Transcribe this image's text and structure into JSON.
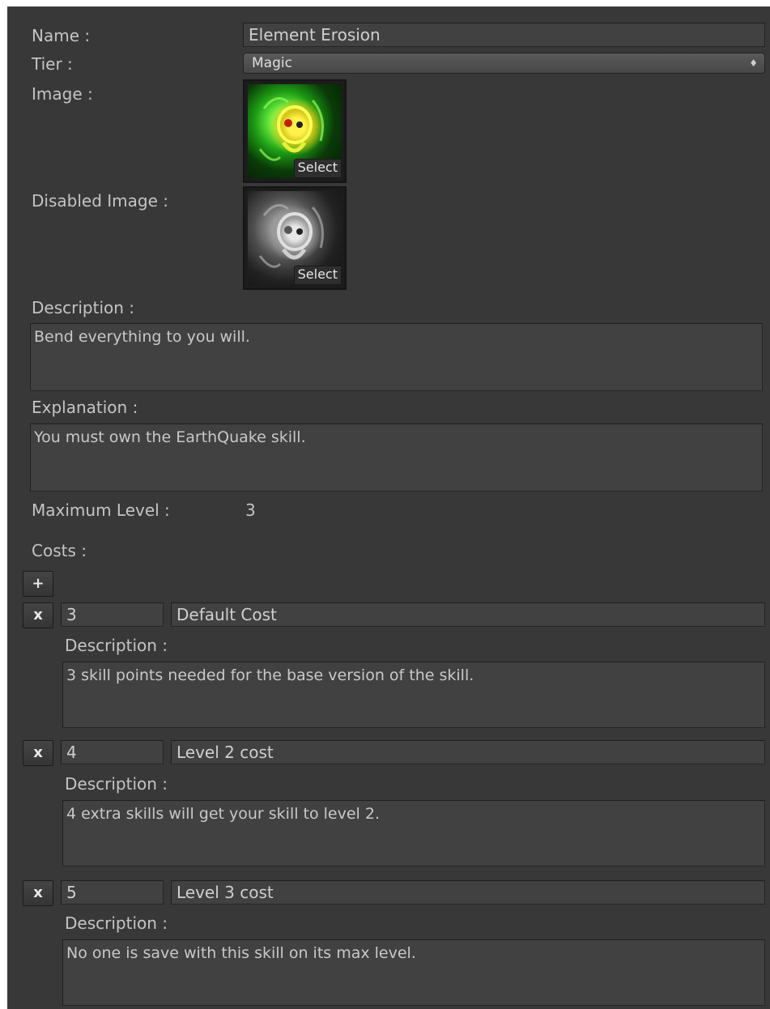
{
  "form": {
    "name_label": "Name :",
    "name_value": "Element Erosion",
    "tier_label": "Tier :",
    "tier_value": "Magic",
    "image_label": "Image :",
    "image_select": "Select",
    "disabled_image_label": "Disabled Image :",
    "disabled_image_select": "Select",
    "description_label": "Description :",
    "description_value": "Bend everything to you will.",
    "explanation_label": "Explanation :",
    "explanation_value": "You must own the EarthQuake skill.",
    "max_level_label": "Maximum Level :",
    "max_level_value": "3",
    "costs_label": "Costs :",
    "add_button": "+",
    "dropdown_arrows": "♦"
  },
  "costs": [
    {
      "remove": "x",
      "amount": "3",
      "name": "Default Cost",
      "desc_label": "Description :",
      "desc": "3 skill points needed for the base version of the skill."
    },
    {
      "remove": "x",
      "amount": "4",
      "name": "Level 2 cost",
      "desc_label": "Description :",
      "desc": "4 extra skills will get your skill to level 2."
    },
    {
      "remove": "x",
      "amount": "5",
      "name": "Level 3 cost",
      "desc_label": "Description :",
      "desc": "No one is save with this skill on its max level."
    }
  ],
  "colors": {
    "panel_bg": "#383838",
    "field_bg": "#414141",
    "text": "#c4c4c4"
  },
  "icons": {
    "image": "skull-icon-green",
    "disabled_image": "skull-icon-gray"
  }
}
